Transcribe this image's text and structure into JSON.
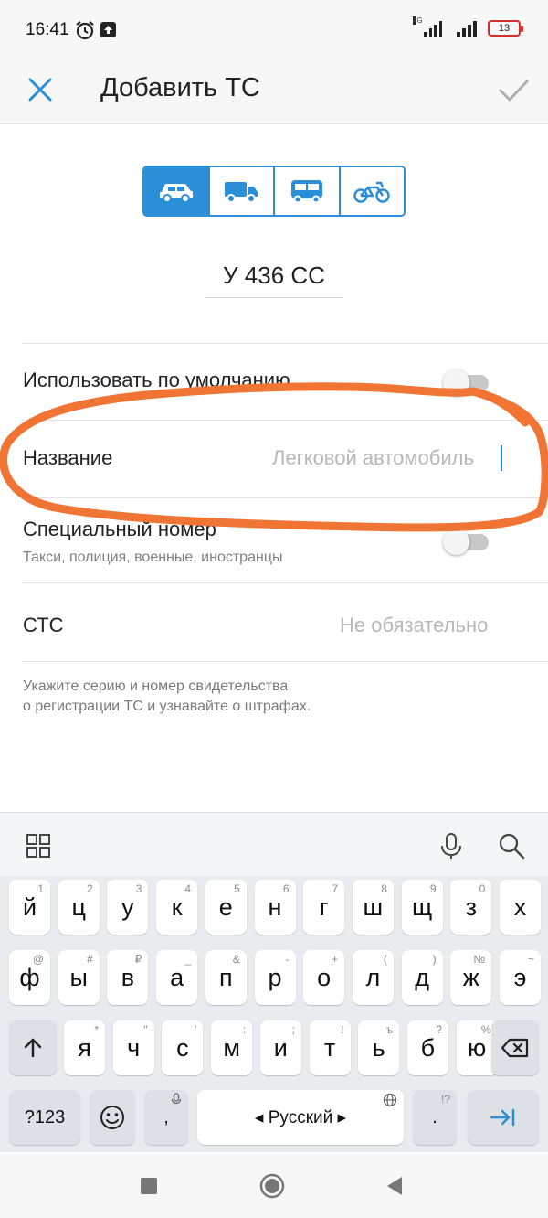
{
  "status_bar": {
    "time": "16:41",
    "network_label": "4G",
    "battery_level": "13",
    "icons": [
      "alarm-icon",
      "upload-icon",
      "signal-icon",
      "battery-icon"
    ]
  },
  "app_bar": {
    "title": "Добавить ТС",
    "close_icon": "close-icon",
    "confirm_icon": "check-icon"
  },
  "vehicle_types": [
    {
      "icon": "car-icon",
      "selected": true
    },
    {
      "icon": "truck-icon",
      "selected": false
    },
    {
      "icon": "bus-icon",
      "selected": false
    },
    {
      "icon": "motorcycle-icon",
      "selected": false
    }
  ],
  "plate_number": "У 436 СС",
  "form": {
    "default_label": "Использовать по умолчанию",
    "default_on": false,
    "name_label": "Название",
    "name_placeholder": "Легковой автомобиль",
    "special_label": "Специальный номер",
    "special_sub": "Такси, полиция, военные, иностранцы",
    "special_on": false,
    "sts_label": "СТС",
    "sts_placeholder": "Не обязательно",
    "hint_line1": "Укажите серию и номер свидетельства",
    "hint_line2": "о регистрации ТС и узнавайте о штрафах."
  },
  "keyboard": {
    "toolbar_icons": [
      "apps-grid-icon",
      "microphone-icon",
      "search-icon"
    ],
    "row1": [
      {
        "k": "й",
        "h": "1"
      },
      {
        "k": "ц",
        "h": "2"
      },
      {
        "k": "у",
        "h": "3"
      },
      {
        "k": "к",
        "h": "4"
      },
      {
        "k": "е",
        "h": "5"
      },
      {
        "k": "н",
        "h": "6"
      },
      {
        "k": "г",
        "h": "7"
      },
      {
        "k": "ш",
        "h": "8"
      },
      {
        "k": "щ",
        "h": "9"
      },
      {
        "k": "з",
        "h": "0"
      },
      {
        "k": "х",
        "h": ""
      }
    ],
    "row2": [
      {
        "k": "ф",
        "h": "@"
      },
      {
        "k": "ы",
        "h": "#"
      },
      {
        "k": "в",
        "h": "₽"
      },
      {
        "k": "а",
        "h": "_"
      },
      {
        "k": "п",
        "h": "&"
      },
      {
        "k": "р",
        "h": "-"
      },
      {
        "k": "о",
        "h": "+"
      },
      {
        "k": "л",
        "h": "("
      },
      {
        "k": "д",
        "h": ")"
      },
      {
        "k": "ж",
        "h": "№"
      },
      {
        "k": "э",
        "h": "~"
      }
    ],
    "row3": [
      {
        "k": "я",
        "h": "*"
      },
      {
        "k": "ч",
        "h": "\""
      },
      {
        "k": "с",
        "h": "'"
      },
      {
        "k": "м",
        "h": ":"
      },
      {
        "k": "и",
        "h": ";"
      },
      {
        "k": "т",
        "h": "!"
      },
      {
        "k": "ь",
        "h": "ъ"
      },
      {
        "k": "б",
        "h": "?"
      },
      {
        "k": "ю",
        "h": "%"
      }
    ],
    "shift_icon": "shift-icon",
    "backspace_icon": "backspace-icon",
    "numbers_key": "?123",
    "emoji_icon": "emoji-icon",
    "comma_key": ",",
    "space_label": "◂ Русский ▸",
    "globe_icon": "globe-icon",
    "period_key": ".",
    "period_hint": "!?",
    "enter_icon": "next-arrow-icon"
  },
  "nav_bar": {
    "icons": [
      "recents-square-icon",
      "home-circle-icon",
      "back-triangle-icon"
    ]
  },
  "annotation": {
    "color": "#f07535"
  }
}
